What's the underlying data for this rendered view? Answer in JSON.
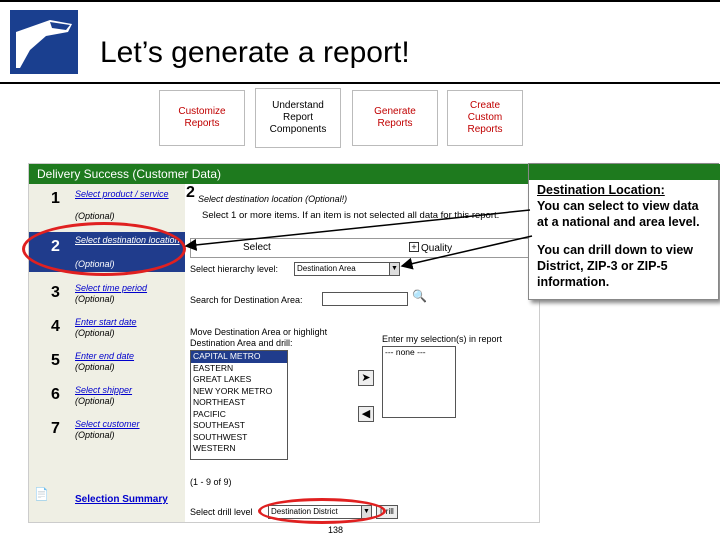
{
  "slide": {
    "title": "Let’s generate a report!",
    "page_number": "138"
  },
  "steps": [
    {
      "label": "Customize Reports"
    },
    {
      "label": "Understand Report Components"
    },
    {
      "label": "Generate Reports"
    },
    {
      "label": "Create Custom Reports"
    }
  ],
  "app": {
    "header": "Delivery Success (Customer Data)",
    "nav": [
      {
        "num": "1",
        "label": "Select product / service",
        "sub": "(Optional)"
      },
      {
        "num": "2",
        "label": "Select destination location",
        "sub": "(Optional)"
      },
      {
        "num": "3",
        "label": "Select time period",
        "sub": "(Optional)"
      },
      {
        "num": "4",
        "label": "Enter start date",
        "sub": "(Optional)"
      },
      {
        "num": "5",
        "label": "Enter end date",
        "sub": "(Optional)"
      },
      {
        "num": "6",
        "label": "Select shipper",
        "sub": "(Optional)"
      },
      {
        "num": "7",
        "label": "Select customer",
        "sub": "(Optional)"
      }
    ],
    "selection_summary": "Selection Summary",
    "main": {
      "step_num": "2",
      "step_label": "Select destination location (Optional!)",
      "instruction": "Select 1 or more items. If an item is not selected all data for this report.",
      "tab_select": "Select",
      "tab_quality": "Quality",
      "hierarchy_label": "Select hierarchy level:",
      "hierarchy_value": "Destination Area",
      "search_label": "Search for Destination Area:",
      "move_label": "Move Destination Area or highlight Destination Area and drill:",
      "areas": [
        "CAPITAL METRO",
        "EASTERN",
        "GREAT LAKES",
        "NEW YORK METRO",
        "NORTHEAST",
        "PACIFIC",
        "SOUTHEAST",
        "SOUTHWEST",
        "WESTERN"
      ],
      "selection_label": "Enter my selection(s) in report",
      "selection_value": "--- none ---",
      "count_text": "(1 - 9 of 9)",
      "drill_label": "Select drill level",
      "drill_value": "Destination District",
      "drill_button": "Drill"
    }
  },
  "callout": {
    "title": "Destination Location:",
    "text1": "You can select to view data at a national and area level.",
    "text2": "You can drill down to view District, ZIP-3 or ZIP-5 information."
  },
  "colors": {
    "header_green": "#1e7a1e",
    "active_blue": "#203c8c",
    "highlight_red": "#e02020",
    "step_red": "#c00000"
  }
}
